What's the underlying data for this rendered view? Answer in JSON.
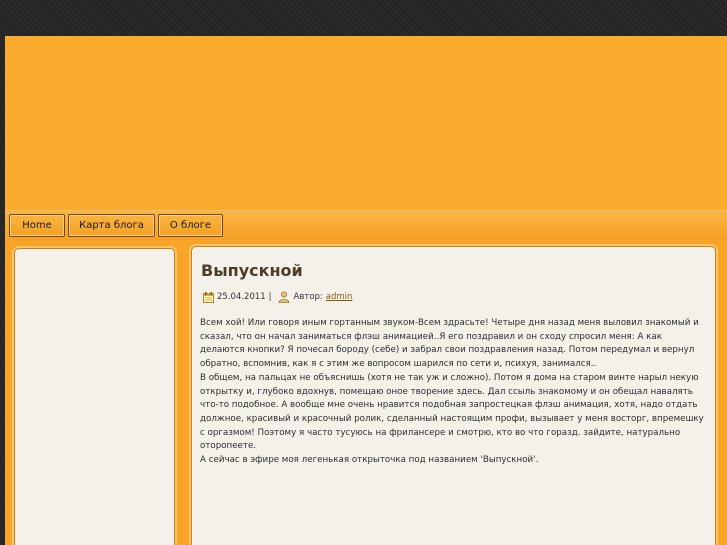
{
  "nav": {
    "items": [
      {
        "label": "Home"
      },
      {
        "label": "Карта блога"
      },
      {
        "label": "О блоге"
      }
    ]
  },
  "post": {
    "title": "Выпускной",
    "date": "25.04.2011",
    "separator": "|",
    "author_label": "Автор:",
    "author": "admin",
    "paragraphs": [
      "Всем хой! Или говоря иным гортанным звуком-Всем здрасьте! Четыре дня назад меня выловил знакомый и сказал, что он начал заниматься флэш анимацией..Я его поздравил и он сходу спросил меня: А как делаются кнопки? Я почесал бороду (себе) и забрал свои поздравления назад. Потом передумал и вернул обратно, вспомнив, как я с этим же вопросом шарился по сети и, психуя, занимался..",
      "В общем, на пальцах не объяснишь (хотя не так уж и сложно). Потом я дома на старом винте нарыл некую открытку и, глубоко вдохнув, помещаю оное творение здесь. Дал ссыль знакомому и он обещал навалять что-то подобное. А вообще мне очень нравится подобная запростецкая флэш анимация, хотя, надо отдать должное, красивый и красочный ролик, сделанный настоящим профи, вызывает у меня восторг, впремешку с оргазмом! Поэтому я часто тусуюсь на фрилансере и смотрю, кто во что горазд. зайдите, натурально оторопеете.",
      "А сейчас в эфире моя легенькая открыточка под названием 'Выпускной'."
    ]
  },
  "icons": {
    "calendar": "calendar-icon",
    "user": "user-icon"
  },
  "colors": {
    "accent": "#fbac2e",
    "panel": "#f4f1ea",
    "border": "#c98015"
  }
}
